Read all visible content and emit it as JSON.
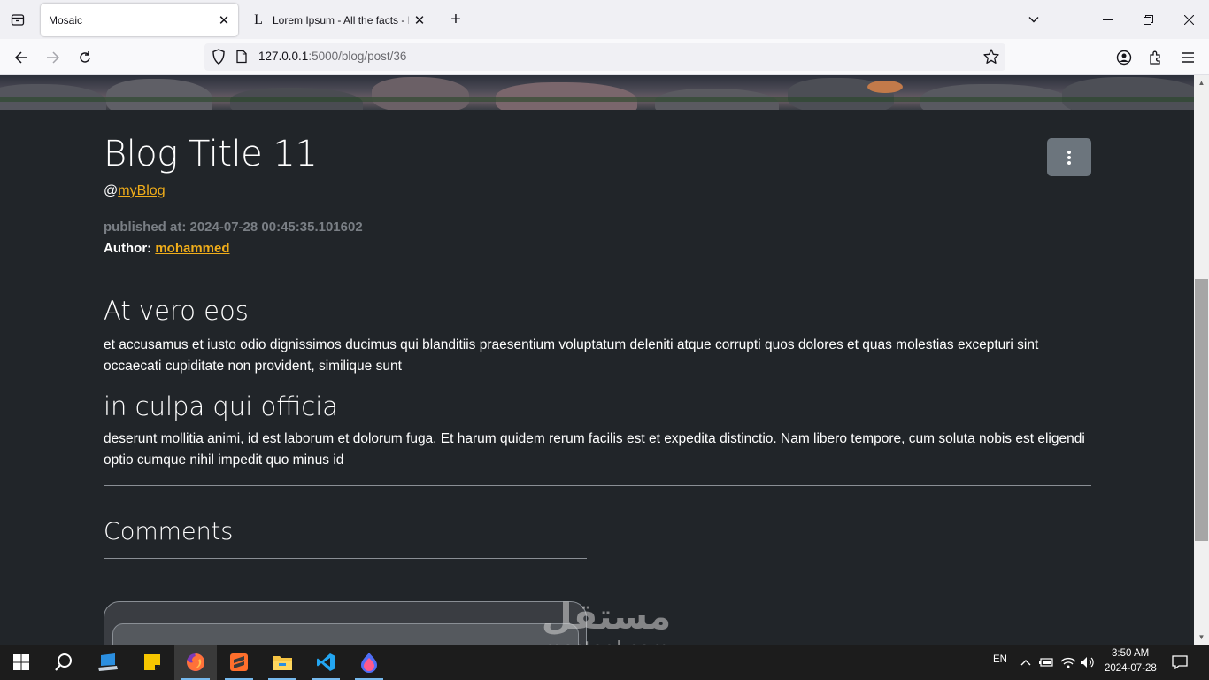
{
  "browser": {
    "tabs": [
      {
        "title": "Mosaic",
        "active": true
      },
      {
        "title": "Lorem Ipsum - All the facts - Lipsum generator",
        "favicon": "L",
        "active": false
      }
    ],
    "url": {
      "host": "127.0.0.1",
      "rest": ":5000/blog/post/36"
    }
  },
  "post": {
    "title": "Blog Title 11",
    "handle_prefix": "@",
    "handle": "myBlog",
    "published": "published at: 2024-07-28 00:45:35.101602",
    "author_label": "Author:",
    "author": "mohammed",
    "sections": [
      {
        "heading": "At vero eos",
        "body": "et accusamus et iusto odio dignissimos ducimus qui blanditiis praesentium voluptatum deleniti atque corrupti quos dolores et quas molestias excepturi sint occaecati cupiditate non provident, similique sunt"
      },
      {
        "heading": "in culpa qui officia",
        "body": "deserunt mollitia animi, id est laborum et dolorum fuga. Et harum quidem rerum facilis est et expedita distinctio. Nam libero tempore, cum soluta nobis est eligendi optio cumque nihil impedit quo minus id"
      }
    ],
    "comments_heading": "Comments"
  },
  "watermark": {
    "arabic": "مستقل",
    "latin": "mostaql.com"
  },
  "taskbar": {
    "language": "EN",
    "time": "3:50 AM",
    "date": "2024-07-28"
  },
  "colors": {
    "accent_link": "#f0ad1a",
    "page_bg": "#212529",
    "menu_button": "#6c757d"
  }
}
